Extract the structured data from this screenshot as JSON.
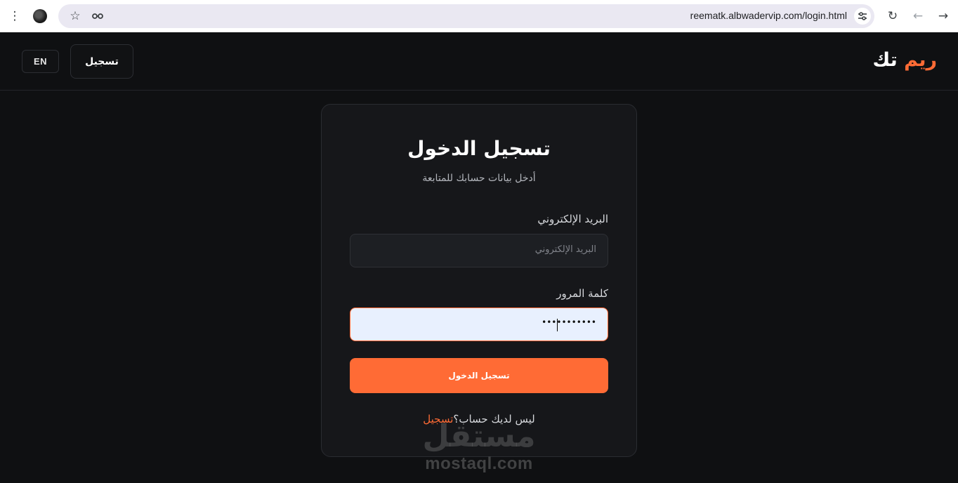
{
  "browser": {
    "url": "reematk.albwadervip.com/login.html",
    "icons": [
      "more-vert-icon",
      "avatar-icon",
      "star-icon",
      "lens-icon",
      "tune-icon",
      "reload-icon",
      "back-arrow-icon",
      "forward-arrow-icon"
    ]
  },
  "header": {
    "logo_part1": "ريم",
    "logo_part2": "تك",
    "register_label": "تسجيل",
    "lang_label": "EN"
  },
  "login": {
    "title": "تسجيل الدخول",
    "subtitle": "أدخل بيانات حسابك للمتابعة",
    "email_label": "البريد الإلكتروني",
    "email_placeholder": "البريد الإلكتروني",
    "password_label": "كلمة المرور",
    "password_value": "•••••••••••",
    "submit_label": "تسجيل الدخول",
    "no_account_text": "ليس لديك حساب؟",
    "signup_link": "تسجيل"
  },
  "watermark": {
    "arabic": "مستقل",
    "latin": "mostaql.com"
  },
  "colors": {
    "accent": "#ff6b35",
    "background": "#0f1012",
    "card": "#16171a"
  }
}
